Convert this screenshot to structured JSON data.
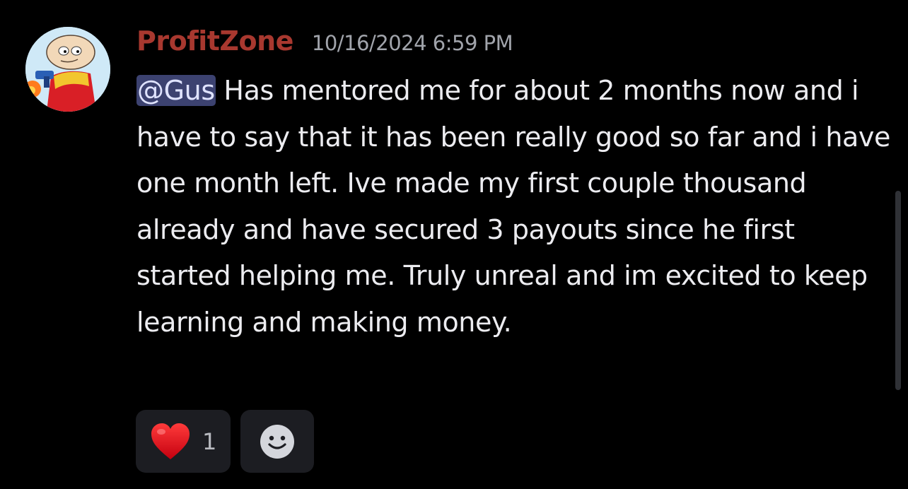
{
  "message": {
    "author": "ProfitZone",
    "author_color": "#a8382f",
    "timestamp": "10/16/2024 6:59 PM",
    "mention": "@Gus",
    "body": " Has mentored me for about 2 months now and i have to say that it has been really good so far and i have one month left. Ive made my first couple thousand already and have secured 3 payouts since he first started helping me. Truly unreal and im excited to keep learning and making money."
  },
  "reactions": [
    {
      "emoji": "heart-icon",
      "count": "1"
    }
  ],
  "add_reaction_icon": "smiley-add-reaction-icon",
  "colors": {
    "background": "#000000",
    "mention_bg": "#3c4270",
    "reaction_bg": "#1c1d22",
    "heart": "#e0111d"
  }
}
